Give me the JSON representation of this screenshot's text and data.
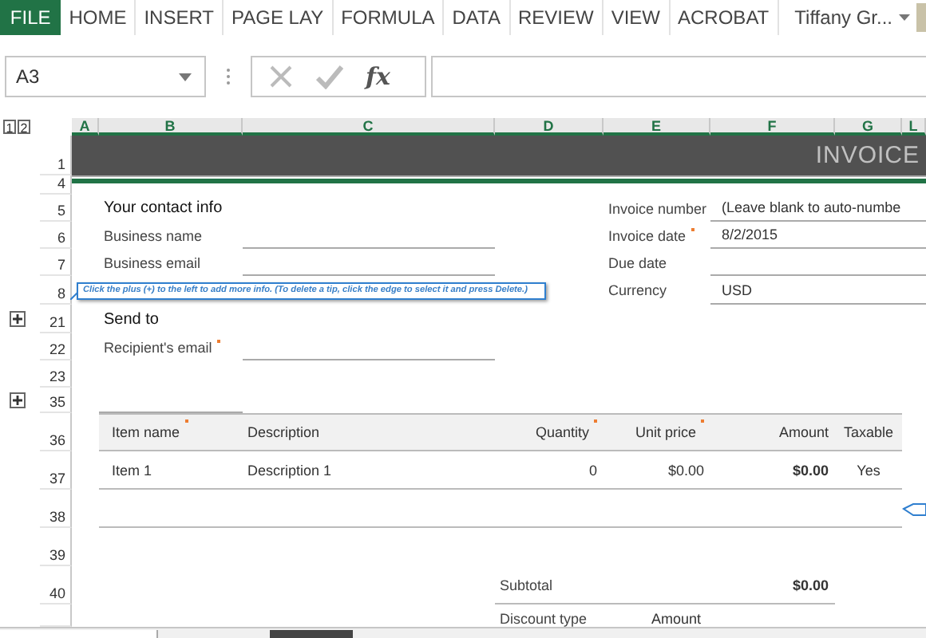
{
  "ribbon": {
    "file_tab": "FILE",
    "tabs": [
      {
        "label": "HOME",
        "selected": false
      },
      {
        "label": "INSERT",
        "selected": false
      },
      {
        "label": "PAGE LAY",
        "selected": false
      },
      {
        "label": "FORMULA",
        "selected": false
      },
      {
        "label": "DATA",
        "selected": false
      },
      {
        "label": "REVIEW",
        "selected": false
      },
      {
        "label": "VIEW",
        "selected": false
      },
      {
        "label": "ACROBAT",
        "selected": false
      }
    ],
    "account": "Tiffany Gr..."
  },
  "formula_bar": {
    "name_box": "A3",
    "function_button": "fx"
  },
  "sheet": {
    "outline_levels": [
      "1",
      "2"
    ],
    "columns": [
      "A",
      "B",
      "C",
      "D",
      "E",
      "F",
      "G",
      "L"
    ],
    "rows": [
      {
        "number": "1",
        "expand_button": false
      },
      {
        "number": "4",
        "expand_button": false
      },
      {
        "number": "5",
        "expand_button": false
      },
      {
        "number": "6",
        "expand_button": false
      },
      {
        "number": "7",
        "expand_button": false
      },
      {
        "number": "8",
        "expand_button": false
      },
      {
        "number": "21",
        "expand_button": true
      },
      {
        "number": "22",
        "expand_button": false
      },
      {
        "number": "23",
        "expand_button": false
      },
      {
        "number": "35",
        "expand_button": true
      },
      {
        "number": "36",
        "expand_button": false
      },
      {
        "number": "37",
        "expand_button": false
      },
      {
        "number": "38",
        "expand_button": false
      },
      {
        "number": "39",
        "expand_button": false
      },
      {
        "number": "40",
        "expand_button": false
      }
    ]
  },
  "title": "INVOICE",
  "contact": {
    "heading": "Your contact info",
    "fields": [
      {
        "label": "Business name",
        "required": false
      },
      {
        "label": "Business email",
        "required": false
      }
    ]
  },
  "invoice_details": [
    {
      "label": "Invoice number",
      "value": "(Leave blank to auto-numbe",
      "required": false
    },
    {
      "label": "Invoice date",
      "value": "8/2/2015",
      "required": true
    },
    {
      "label": "Due date",
      "required": false
    },
    {
      "label": "Currency",
      "value": "USD",
      "required": false
    }
  ],
  "tip": "Click the plus (+) to the left to add more info. (To delete a tip, click the edge to select it and press Delete.)",
  "send_to": {
    "heading": "Send to",
    "fields": [
      {
        "label": "Recipient's email",
        "required": true
      }
    ]
  },
  "items_table": {
    "columns": [
      {
        "label": "Item name",
        "required": true
      },
      {
        "label": "Description",
        "required": false
      },
      {
        "label": "Quantity",
        "required": true
      },
      {
        "label": "Unit price",
        "required": true
      },
      {
        "label": "Amount",
        "required": false
      },
      {
        "label": "Taxable",
        "required": false
      }
    ],
    "rows": [
      {
        "cells": [
          "Item 1",
          "Description 1",
          "0",
          "$0.00",
          "$0.00",
          "Yes"
        ]
      }
    ]
  },
  "totals": [
    {
      "label": "Subtotal",
      "value": "$0.00"
    }
  ],
  "discount": {
    "label": "Discount type",
    "value": "Amount"
  }
}
